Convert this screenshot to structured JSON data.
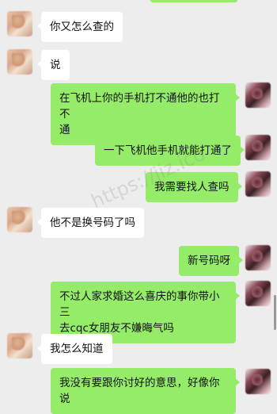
{
  "watermark": "https://jiz.ico",
  "messages": [
    {
      "side": "left",
      "text": "你又怎么查的"
    },
    {
      "side": "left",
      "text": "说"
    },
    {
      "side": "right",
      "text": "在飞机上你的手机打不通他的也打不\n通"
    },
    {
      "side": "right",
      "text": "一下飞机他手机就能打通了"
    },
    {
      "side": "right",
      "text": "我需要找人查吗"
    },
    {
      "side": "left",
      "text": "他不是换号码了吗"
    },
    {
      "side": "right",
      "text": "新号码呀"
    },
    {
      "side": "right",
      "text": "不过人家求婚这么喜庆的事你带小三\n去cqc女朋友不嫌晦气吗"
    },
    {
      "side": "left",
      "text": "我怎么知道"
    },
    {
      "side": "right",
      "text": "我没有要跟你讨好的意思，好像你说"
    }
  ]
}
